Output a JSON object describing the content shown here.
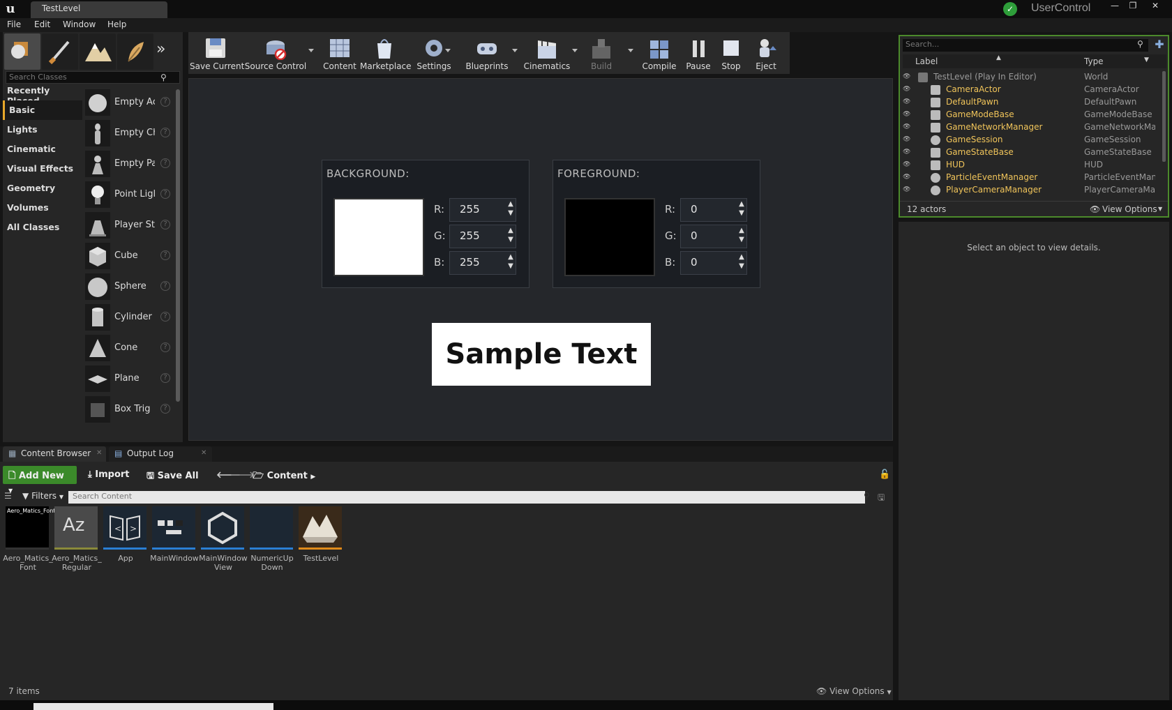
{
  "window": {
    "tab_title": "TestLevel",
    "user_name": "UserControl",
    "minimize": "—",
    "restore": "❐",
    "close": "✕"
  },
  "menu": [
    "File",
    "Edit",
    "Window",
    "Help"
  ],
  "modes": {
    "search_placeholder": "Search Classes",
    "categories": [
      "Recently Placed",
      "Basic",
      "Lights",
      "Cinematic",
      "Visual Effects",
      "Geometry",
      "Volumes",
      "All Classes"
    ],
    "active_category": "Basic",
    "items": [
      "Empty Ac",
      "Empty Ch",
      "Empty Pa",
      "Point Ligl",
      "Player St",
      "Cube",
      "Sphere",
      "Cylinder",
      "Cone",
      "Plane",
      "Box Trig"
    ]
  },
  "toolbar": [
    {
      "label": "Save Current",
      "icon": "save-icon"
    },
    {
      "label": "Source Control",
      "icon": "source-control-icon"
    },
    {
      "label": "Content",
      "icon": "content-icon"
    },
    {
      "label": "Marketplace",
      "icon": "marketplace-icon"
    },
    {
      "label": "Settings",
      "icon": "settings-icon"
    },
    {
      "label": "Blueprints",
      "icon": "blueprints-icon"
    },
    {
      "label": "Cinematics",
      "icon": "cinematics-icon"
    },
    {
      "label": "Build",
      "icon": "build-icon"
    },
    {
      "label": "Compile",
      "icon": "compile-icon"
    },
    {
      "label": "Pause",
      "icon": "pause-icon"
    },
    {
      "label": "Stop",
      "icon": "stop-icon"
    },
    {
      "label": "Eject",
      "icon": "eject-icon"
    }
  ],
  "viewport": {
    "background": {
      "title": "BACKGROUND:",
      "r": "255",
      "g": "255",
      "b": "255",
      "swatch": "#ffffff"
    },
    "foreground": {
      "title": "FOREGROUND:",
      "r": "0",
      "g": "0",
      "b": "0",
      "swatch": "#000000"
    },
    "r_label": "R:",
    "g_label": "G:",
    "b_label": "B:",
    "sample_text": "Sample Text"
  },
  "outliner": {
    "search_placeholder": "Search...",
    "col_label": "Label",
    "col_type": "Type",
    "rows": [
      {
        "label": "TestLevel (Play In Editor)",
        "type": "World"
      },
      {
        "label": "CameraActor",
        "type": "CameraActor"
      },
      {
        "label": "DefaultPawn",
        "type": "DefaultPawn"
      },
      {
        "label": "GameModeBase",
        "type": "GameModeBase"
      },
      {
        "label": "GameNetworkManager",
        "type": "GameNetworkMan"
      },
      {
        "label": "GameSession",
        "type": "GameSession"
      },
      {
        "label": "GameStateBase",
        "type": "GameStateBase"
      },
      {
        "label": "HUD",
        "type": "HUD"
      },
      {
        "label": "ParticleEventManager",
        "type": "ParticleEventMana"
      },
      {
        "label": "PlayerCameraManager",
        "type": "PlayerCameraMan"
      }
    ],
    "count": "12 actors",
    "view_options": "View Options"
  },
  "details": {
    "message": "Select an object to view details."
  },
  "content_browser": {
    "tabs": [
      "Content Browser",
      "Output Log"
    ],
    "add_new": "Add New",
    "import": "Import",
    "save_all": "Save All",
    "path": "Content",
    "filters": "Filters",
    "search_placeholder": "Search Content",
    "assets": [
      {
        "name": "Aero_Matics_\nFont",
        "thumb_text": "Aero_Matics_Font"
      },
      {
        "name": "Aero_Matics_\nRegular",
        "thumb_text": "Az"
      },
      {
        "name": "App",
        "thumb_text": ""
      },
      {
        "name": "MainWindow",
        "thumb_text": ""
      },
      {
        "name": "MainWindow\nView",
        "thumb_text": ""
      },
      {
        "name": "NumericUp\nDown",
        "thumb_text": ""
      },
      {
        "name": "TestLevel",
        "thumb_text": ""
      }
    ],
    "count": "7 items",
    "view_options": "View Options"
  }
}
